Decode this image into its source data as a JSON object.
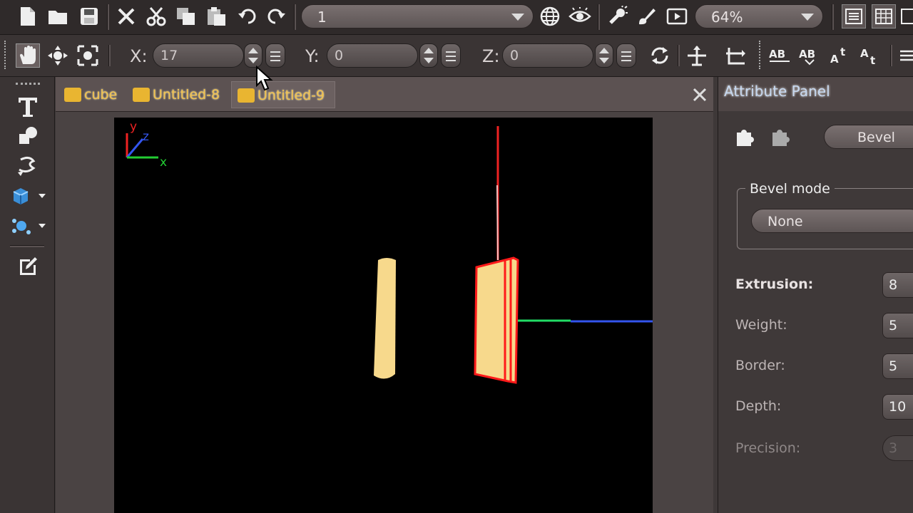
{
  "toolbar": {
    "layer_select": "1",
    "zoom": "64%"
  },
  "transform": {
    "x_label": "X:",
    "x_value": "17",
    "y_label": "Y:",
    "y_value": "0",
    "z_label": "Z:",
    "z_value": "0"
  },
  "tabs": [
    {
      "label": "cube"
    },
    {
      "label": "Untitled-8"
    },
    {
      "label": "Untitled-9"
    }
  ],
  "viewport": {
    "axes": {
      "y": "y",
      "z": "z",
      "x": "x"
    }
  },
  "attribute_panel": {
    "title": "Attribute Panel",
    "section_button": "Bevel",
    "bevel_mode_label": "Bevel mode",
    "bevel_mode_value": "None",
    "properties": [
      {
        "label": "Extrusion:",
        "value": "8"
      },
      {
        "label": "Weight:",
        "value": "5"
      },
      {
        "label": "Border:",
        "value": "5"
      },
      {
        "label": "Depth:",
        "value": "10"
      },
      {
        "label": "Precision:",
        "value": "3"
      }
    ]
  },
  "colors": {
    "axis_x": "#22cc33",
    "axis_y": "#ee2222",
    "axis_z": "#3355ee",
    "object_fill": "#f7d98c",
    "selection": "#ff1a1a"
  }
}
